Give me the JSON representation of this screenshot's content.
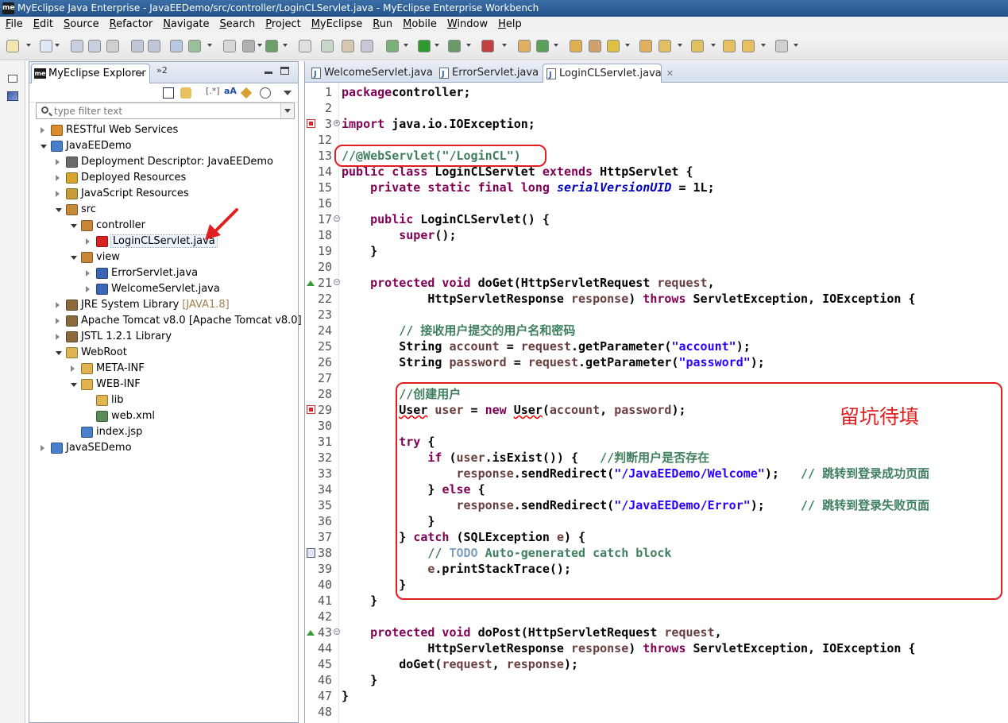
{
  "window": {
    "title": "MyEclipse Java Enterprise - JavaEEDemo/src/controller/LoginCLServlet.java - MyEclipse Enterprise Workbench",
    "app_icon": "me"
  },
  "menu": [
    "File",
    "Edit",
    "Source",
    "Refactor",
    "Navigate",
    "Search",
    "Project",
    "MyEclipse",
    "Run",
    "Mobile",
    "Window",
    "Help"
  ],
  "explorer": {
    "tab_label": "MyEclipse Explorer",
    "tab_close": "✕",
    "overflow_label": "»2",
    "filter_placeholder": "type filter text",
    "tools": {
      "aa_label": "aA",
      "regex_label": "[.*]"
    },
    "nodes": [
      {
        "label": "RESTful Web Services",
        "extra": "",
        "depth": 0,
        "arrow": "closed",
        "icon": "rest-services-icon",
        "color": "#d98c2b"
      },
      {
        "label": "JavaEEDemo",
        "extra": "",
        "depth": 0,
        "arrow": "open",
        "icon": "web-project-icon",
        "color": "#4a7fc9"
      },
      {
        "label": "Deployment Descriptor: JavaEEDemo",
        "extra": "",
        "depth": 1,
        "arrow": "closed",
        "icon": "deployment-descriptor-icon",
        "color": "#6b6b6b"
      },
      {
        "label": "Deployed Resources",
        "extra": "",
        "depth": 1,
        "arrow": "closed",
        "icon": "deployed-resources-icon",
        "color": "#d6a530"
      },
      {
        "label": "JavaScript Resources",
        "extra": "",
        "depth": 1,
        "arrow": "closed",
        "icon": "javascript-resources-icon",
        "color": "#c99a3a"
      },
      {
        "label": "src",
        "extra": "",
        "depth": 1,
        "arrow": "open",
        "icon": "source-folder-icon",
        "color": "#c9873a"
      },
      {
        "label": "controller",
        "extra": "",
        "depth": 2,
        "arrow": "open",
        "icon": "package-icon",
        "color": "#c9873a"
      },
      {
        "label": "LoginCLServlet.java",
        "extra": "",
        "depth": 3,
        "arrow": "closed",
        "icon": "java-file-error-icon",
        "color": "#d22"
      },
      {
        "label": "view",
        "extra": "",
        "depth": 2,
        "arrow": "open",
        "icon": "package-icon",
        "color": "#c9873a"
      },
      {
        "label": "ErrorServlet.java",
        "extra": "",
        "depth": 3,
        "arrow": "closed",
        "icon": "java-file-icon",
        "color": "#3a66b5"
      },
      {
        "label": "WelcomeServlet.java",
        "extra": "",
        "depth": 3,
        "arrow": "closed",
        "icon": "java-file-icon",
        "color": "#3a66b5"
      },
      {
        "label": "JRE System Library",
        "extra": "[JAVA1.8]",
        "depth": 1,
        "arrow": "closed",
        "icon": "library-icon",
        "color": "#8a6a3a"
      },
      {
        "label": "Apache Tomcat v8.0 [Apache Tomcat v8.0]",
        "extra": "",
        "depth": 1,
        "arrow": "closed",
        "icon": "library-icon",
        "color": "#8a6a3a"
      },
      {
        "label": "JSTL 1.2.1 Library",
        "extra": "",
        "depth": 1,
        "arrow": "closed",
        "icon": "library-icon",
        "color": "#8a6a3a"
      },
      {
        "label": "WebRoot",
        "extra": "",
        "depth": 1,
        "arrow": "open",
        "icon": "folder-icon",
        "color": "#e0b450"
      },
      {
        "label": "META-INF",
        "extra": "",
        "depth": 2,
        "arrow": "closed",
        "icon": "folder-icon",
        "color": "#e0b450"
      },
      {
        "label": "WEB-INF",
        "extra": "",
        "depth": 2,
        "arrow": "open",
        "icon": "folder-icon",
        "color": "#e0b450"
      },
      {
        "label": "lib",
        "extra": "",
        "depth": 3,
        "arrow": "none",
        "icon": "folder-icon",
        "color": "#e0b450"
      },
      {
        "label": "web.xml",
        "extra": "",
        "depth": 3,
        "arrow": "none",
        "icon": "xml-file-icon",
        "color": "#5a8a5a"
      },
      {
        "label": "index.jsp",
        "extra": "",
        "depth": 2,
        "arrow": "none",
        "icon": "jsp-file-icon",
        "color": "#4a7fc9"
      },
      {
        "label": "JavaSEDemo",
        "extra": "",
        "depth": 0,
        "arrow": "closed",
        "icon": "java-project-icon",
        "color": "#4a7fc9"
      }
    ]
  },
  "editor": {
    "tabs": [
      {
        "label": "WelcomeServlet.java",
        "active": false
      },
      {
        "label": "ErrorServlet.java",
        "active": false
      },
      {
        "label": "LoginCLServlet.java",
        "active": true
      }
    ],
    "tab_close": "✕",
    "lines": [
      {
        "n": "1",
        "segs": [
          [
            "kw",
            "package"
          ],
          [
            "",
            "controller;"
          ]
        ]
      },
      {
        "n": "2",
        "segs": []
      },
      {
        "n": "3",
        "segs": [
          [
            "kw",
            "import"
          ],
          [
            "",
            " java.io.IOException;"
          ]
        ],
        "marker": "error",
        "fold": "+"
      },
      {
        "n": "12",
        "segs": []
      },
      {
        "n": "13",
        "segs": [
          [
            "cm",
            "//@WebServlet(\"/LoginCL\")"
          ]
        ]
      },
      {
        "n": "14",
        "segs": [
          [
            "kw",
            "public class"
          ],
          [
            "",
            " LoginCLServlet "
          ],
          [
            "kw",
            "extends"
          ],
          [
            "",
            " HttpServlet {"
          ]
        ]
      },
      {
        "n": "15",
        "segs": [
          [
            "",
            "    "
          ],
          [
            "kw",
            "private static final long"
          ],
          [
            "",
            " "
          ],
          [
            "fld",
            "serialVersionUID"
          ],
          [
            "",
            " = 1L;"
          ]
        ]
      },
      {
        "n": "16",
        "segs": []
      },
      {
        "n": "17",
        "segs": [
          [
            "",
            "    "
          ],
          [
            "kw",
            "public"
          ],
          [
            "",
            " LoginCLServlet() {"
          ]
        ],
        "fold": "-"
      },
      {
        "n": "18",
        "segs": [
          [
            "",
            "        "
          ],
          [
            "kw",
            "super"
          ],
          [
            "",
            "();"
          ]
        ]
      },
      {
        "n": "19",
        "segs": [
          [
            "",
            "    }"
          ]
        ]
      },
      {
        "n": "20",
        "segs": []
      },
      {
        "n": "21",
        "segs": [
          [
            "",
            "    "
          ],
          [
            "kw",
            "protected void"
          ],
          [
            "",
            " doGet(HttpServletRequest "
          ],
          [
            "var",
            "request"
          ],
          [
            "",
            ","
          ]
        ],
        "marker": "override",
        "fold": "-"
      },
      {
        "n": "22",
        "segs": [
          [
            "",
            "            HttpServletResponse "
          ],
          [
            "var",
            "response"
          ],
          [
            "",
            ") "
          ],
          [
            "kw",
            "throws"
          ],
          [
            "",
            " ServletException, IOException {"
          ]
        ]
      },
      {
        "n": "23",
        "segs": []
      },
      {
        "n": "24",
        "segs": [
          [
            "",
            "        "
          ],
          [
            "cm",
            "// 接收用户提交的用户名和密码"
          ]
        ]
      },
      {
        "n": "25",
        "segs": [
          [
            "",
            "        String "
          ],
          [
            "var",
            "account"
          ],
          [
            "",
            " = "
          ],
          [
            "var",
            "request"
          ],
          [
            "",
            ".getParameter("
          ],
          [
            "st",
            "\"account\""
          ],
          [
            "",
            ");"
          ]
        ]
      },
      {
        "n": "26",
        "segs": [
          [
            "",
            "        String "
          ],
          [
            "var",
            "password"
          ],
          [
            "",
            " = "
          ],
          [
            "var",
            "request"
          ],
          [
            "",
            ".getParameter("
          ],
          [
            "st",
            "\"password\""
          ],
          [
            "",
            ");"
          ]
        ]
      },
      {
        "n": "27",
        "segs": []
      },
      {
        "n": "28",
        "segs": [
          [
            "",
            "        "
          ],
          [
            "cm",
            "//创建用户"
          ]
        ]
      },
      {
        "n": "29",
        "segs": [
          [
            "",
            "        "
          ],
          [
            "err",
            "User"
          ],
          [
            "",
            " "
          ],
          [
            "var",
            "user"
          ],
          [
            "",
            " = "
          ],
          [
            "kw",
            "new"
          ],
          [
            "",
            " "
          ],
          [
            "err",
            "User"
          ],
          [
            "",
            "("
          ],
          [
            "var",
            "account"
          ],
          [
            "",
            ", "
          ],
          [
            "var",
            "password"
          ],
          [
            "",
            ");"
          ]
        ],
        "marker": "error"
      },
      {
        "n": "30",
        "segs": []
      },
      {
        "n": "31",
        "segs": [
          [
            "",
            "        "
          ],
          [
            "kw",
            "try"
          ],
          [
            "",
            " {"
          ]
        ]
      },
      {
        "n": "32",
        "segs": [
          [
            "",
            "            "
          ],
          [
            "kw",
            "if"
          ],
          [
            "",
            " ("
          ],
          [
            "var",
            "user"
          ],
          [
            "",
            ".isExist()) {   "
          ],
          [
            "cm",
            "//判断用户是否存在"
          ]
        ]
      },
      {
        "n": "33",
        "segs": [
          [
            "",
            "                "
          ],
          [
            "var",
            "response"
          ],
          [
            "",
            ".sendRedirect("
          ],
          [
            "st",
            "\"/JavaEEDemo/Welcome\""
          ],
          [
            "",
            ");   "
          ],
          [
            "cm",
            "// 跳转到登录成功页面"
          ]
        ]
      },
      {
        "n": "34",
        "segs": [
          [
            "",
            "            } "
          ],
          [
            "kw",
            "else"
          ],
          [
            "",
            " {"
          ]
        ]
      },
      {
        "n": "35",
        "segs": [
          [
            "",
            "                "
          ],
          [
            "var",
            "response"
          ],
          [
            "",
            ".sendRedirect("
          ],
          [
            "st",
            "\"/JavaEEDemo/Error\""
          ],
          [
            "",
            ");     "
          ],
          [
            "cm",
            "// 跳转到登录失败页面"
          ]
        ]
      },
      {
        "n": "36",
        "segs": [
          [
            "",
            "            }"
          ]
        ]
      },
      {
        "n": "37",
        "segs": [
          [
            "",
            "        } "
          ],
          [
            "kw",
            "catch"
          ],
          [
            "",
            " (SQLException "
          ],
          [
            "var",
            "e"
          ],
          [
            "",
            ") {"
          ]
        ]
      },
      {
        "n": "38",
        "segs": [
          [
            "",
            "            "
          ],
          [
            "cm",
            "// "
          ],
          [
            "todo",
            "TODO"
          ],
          [
            "cm",
            " Auto-generated catch block"
          ]
        ],
        "marker": "task"
      },
      {
        "n": "39",
        "segs": [
          [
            "",
            "            "
          ],
          [
            "var",
            "e"
          ],
          [
            "",
            ".printStackTrace();"
          ]
        ]
      },
      {
        "n": "40",
        "segs": [
          [
            "",
            "        }"
          ]
        ]
      },
      {
        "n": "41",
        "segs": [
          [
            "",
            "    }"
          ]
        ]
      },
      {
        "n": "42",
        "segs": []
      },
      {
        "n": "43",
        "segs": [
          [
            "",
            "    "
          ],
          [
            "kw",
            "protected void"
          ],
          [
            "",
            " doPost(HttpServletRequest "
          ],
          [
            "var",
            "request"
          ],
          [
            "",
            ","
          ]
        ],
        "marker": "override",
        "fold": "-"
      },
      {
        "n": "44",
        "segs": [
          [
            "",
            "            HttpServletResponse "
          ],
          [
            "var",
            "response"
          ],
          [
            "",
            ") "
          ],
          [
            "kw",
            "throws"
          ],
          [
            "",
            " ServletException, IOException {"
          ]
        ]
      },
      {
        "n": "45",
        "segs": [
          [
            "",
            "        doGet("
          ],
          [
            "var",
            "request"
          ],
          [
            "",
            ", "
          ],
          [
            "var",
            "response"
          ],
          [
            "",
            ");"
          ]
        ]
      },
      {
        "n": "46",
        "segs": [
          [
            "",
            "    }"
          ]
        ]
      },
      {
        "n": "47",
        "segs": [
          [
            "",
            "}"
          ]
        ]
      },
      {
        "n": "48",
        "segs": []
      }
    ]
  },
  "annotation": {
    "text": "留坑待填",
    "color": "#e02020"
  }
}
